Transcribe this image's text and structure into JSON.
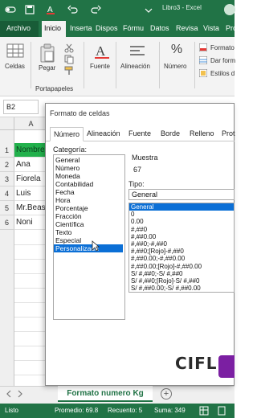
{
  "titlebar": {
    "app_title": "Libro3  -  Excel",
    "icons": [
      "autosave-icon",
      "save-icon",
      "font-color-icon",
      "undo-icon",
      "redo-icon",
      "customize-icon"
    ]
  },
  "ribbon": {
    "tabs": [
      "Archivo",
      "Inicio",
      "Inserta",
      "Dispos",
      "Fórmu",
      "Datos",
      "Revisa",
      "Vista",
      "Pro"
    ],
    "groups": {
      "celdas": "Celdas",
      "pegar": "Pegar",
      "portapapeles": "Portapapeles",
      "fuente": "Fuente",
      "alineacion": "Alineación",
      "numero": "Número",
      "number_glyph": "%"
    },
    "styles": [
      "Formato",
      "Dar form",
      "Estilos d"
    ]
  },
  "formula_bar": {
    "name_box": "B2"
  },
  "grid": {
    "columns": [
      "A"
    ],
    "rows": [
      {
        "n": "1",
        "a": "Nombre"
      },
      {
        "n": "2",
        "a": "Ana"
      },
      {
        "n": "3",
        "a": "Fiorela"
      },
      {
        "n": "4",
        "a": "Luis"
      },
      {
        "n": "5",
        "a": "Mr.Beas"
      },
      {
        "n": "6",
        "a": "Noni"
      }
    ],
    "header_fill": "#22b14c"
  },
  "sheet": {
    "tab_name": "Formato numero Kg",
    "add_symbol": "+"
  },
  "status": {
    "ready": "Listo",
    "average": "Promedio: 69.8",
    "count": "Recuento: 5",
    "sum": "Suma: 349"
  },
  "dialog": {
    "title": "Formato de celdas",
    "tabs": [
      "Número",
      "Alineación",
      "Fuente",
      "Borde",
      "Relleno",
      "Prot"
    ],
    "category_label": "Categoría:",
    "categories": [
      "General",
      "Número",
      "Moneda",
      "Contabilidad",
      "Fecha",
      "Hora",
      "Porcentaje",
      "Fracción",
      "Científica",
      "Texto",
      "Especial",
      "Personalizada"
    ],
    "selected_category": "Personalizada",
    "sample_label": "Muestra",
    "sample_value": "67",
    "type_label": "Tipo:",
    "type_value": "General",
    "formats": [
      "General",
      "0",
      "0.00",
      "#,##0",
      "#,##0.00",
      "#,##0;-#,##0",
      "#,##0;[Rojo]-#,##0",
      "#,##0.00;-#,##0.00",
      "#,##0.00;[Rojo]-#,##0.00",
      "S/ #,##0;-S/ #,##0",
      "S/ #,##0;[Rojo]-S/ #,##0",
      "S/ #,##0.00;-S/ #,##0.00"
    ],
    "selected_format": "General"
  },
  "logo": {
    "text": "CIFL"
  },
  "colors": {
    "excel_green": "#217346",
    "selection_blue": "#0b6fd6"
  }
}
